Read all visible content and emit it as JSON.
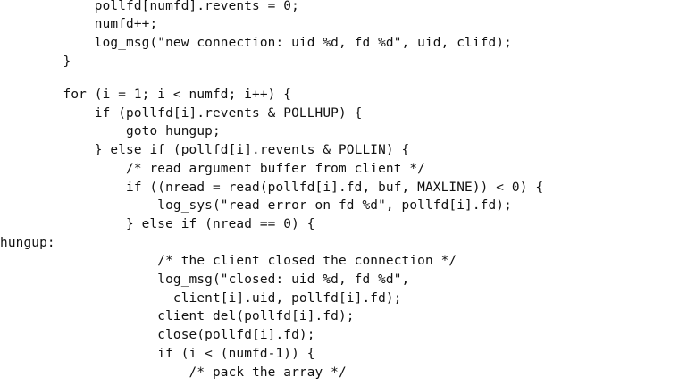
{
  "code": {
    "lines": [
      "            pollfd[numfd].revents = 0;",
      "            numfd++;",
      "            log_msg(\"new connection: uid %d, fd %d\", uid, clifd);",
      "        }",
      "",
      "        for (i = 1; i < numfd; i++) {",
      "            if (pollfd[i].revents & POLLHUP) {",
      "                goto hungup;",
      "            } else if (pollfd[i].revents & POLLIN) {",
      "                /* read argument buffer from client */",
      "                if ((nread = read(pollfd[i].fd, buf, MAXLINE)) < 0) {",
      "                    log_sys(\"read error on fd %d\", pollfd[i].fd);",
      "                } else if (nread == 0) {",
      "hungup:",
      "                    /* the client closed the connection */",
      "                    log_msg(\"closed: uid %d, fd %d\",",
      "                      client[i].uid, pollfd[i].fd);",
      "                    client_del(pollfd[i].fd);",
      "                    close(pollfd[i].fd);",
      "                    if (i < (numfd-1)) {",
      "                        /* pack the array */"
    ]
  }
}
